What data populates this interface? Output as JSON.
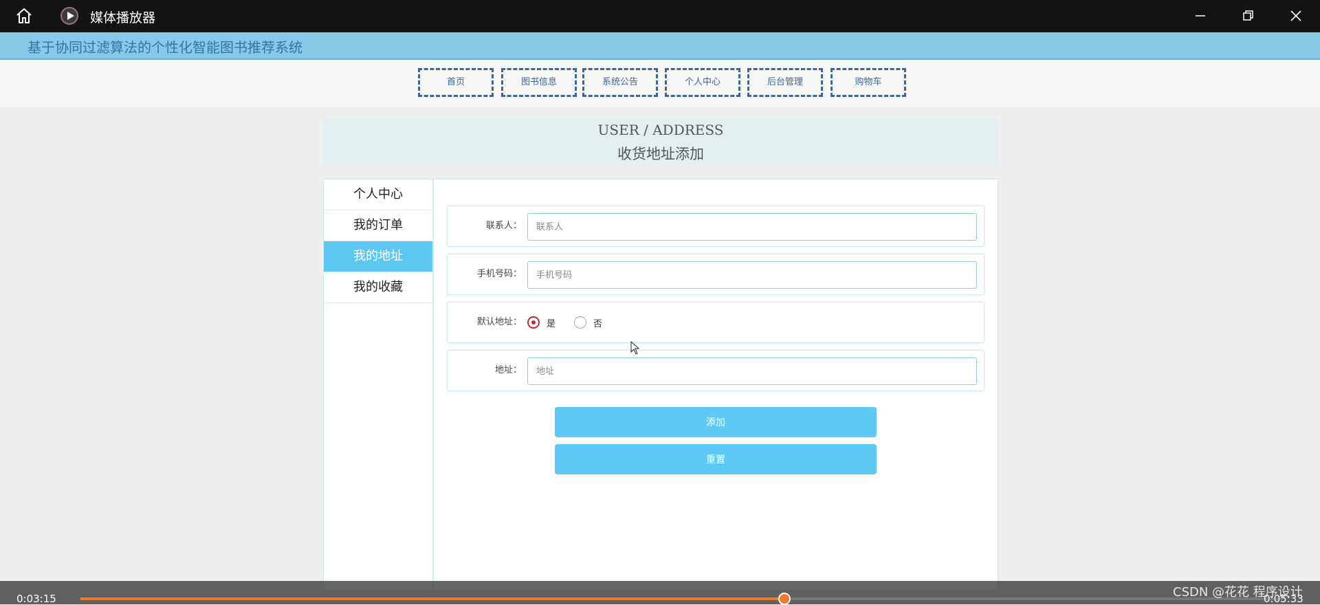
{
  "player": {
    "title": "媒体播放器",
    "current_time": "0:03:15",
    "total_time": "0:05:33",
    "progress_fraction": 0.585,
    "accent_color": "#f07a2a"
  },
  "site": {
    "title": "基于协同过滤算法的个性化智能图书推荐系统"
  },
  "nav": {
    "items": [
      "首页",
      "图书信息",
      "系统公告",
      "个人中心",
      "后台管理",
      "购物车"
    ]
  },
  "page": {
    "title_en": "USER / ADDRESS",
    "title_cn": "收货地址添加"
  },
  "sidebar": {
    "items": [
      "个人中心",
      "我的订单",
      "我的地址",
      "我的收藏"
    ],
    "active": "我的地址"
  },
  "form": {
    "contact": {
      "label": "联系人：",
      "placeholder": "联系人",
      "value": ""
    },
    "phone": {
      "label": "手机号码：",
      "placeholder": "手机号码",
      "value": ""
    },
    "default_address": {
      "label": "默认地址：",
      "options": [
        "是",
        "否"
      ],
      "selected": "是"
    },
    "address": {
      "label": "地址：",
      "placeholder": "地址",
      "value": ""
    },
    "submit_label": "添加",
    "reset_label": "重置"
  },
  "watermark": "CSDN @花花 程序设计",
  "colors": {
    "header_bg": "#88c8e8",
    "active_bg": "#5cc8f2",
    "button_bg": "#5ec9f4",
    "nav_border": "#3d6598"
  }
}
